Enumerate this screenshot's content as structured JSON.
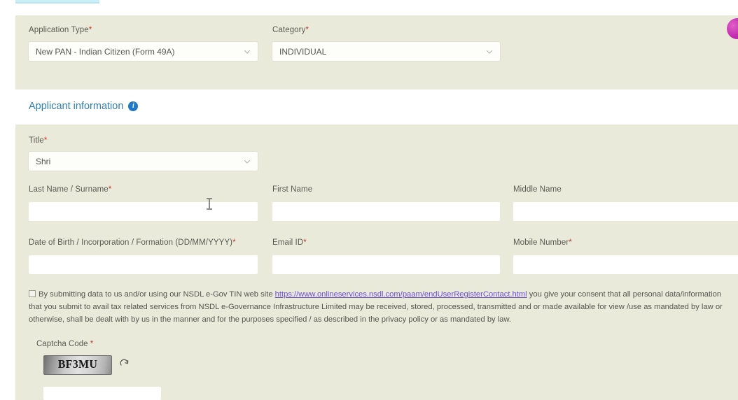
{
  "top_tab": {
    "present": true
  },
  "application_panel": {
    "application_type": {
      "label": "Application Type",
      "required": "*",
      "value": "New PAN - Indian Citizen (Form 49A)"
    },
    "category": {
      "label": "Category",
      "required": "*",
      "value": "INDIVIDUAL"
    }
  },
  "section": {
    "heading": "Applicant information",
    "info_icon": "info-icon",
    "info_glyph": "i"
  },
  "applicant_panel": {
    "title_field": {
      "label": "Title",
      "required": "*",
      "value": "Shri"
    },
    "last_name": {
      "label": "Last Name / Surname",
      "required": "*",
      "value": ""
    },
    "first_name": {
      "label": "First Name",
      "required": "",
      "value": ""
    },
    "middle_name": {
      "label": "Middle Name",
      "required": "",
      "value": ""
    },
    "dob": {
      "label": "Date of Birth / Incorporation / Formation (DD/MM/YYYY)",
      "required": "*",
      "value": ""
    },
    "email": {
      "label": "Email ID",
      "required": "*",
      "value": ""
    },
    "mobile": {
      "label": "Mobile Number",
      "required": "*",
      "value": ""
    }
  },
  "consent": {
    "checked": false,
    "text_before_link": "By submitting data to us and/or using our NSDL e-Gov TIN web site ",
    "link_text": "https://www.onlineservices.nsdl.com/paam/endUserRegisterContact.html",
    "text_after_link": " you give your consent that all personal data/information that you submit to avail tax related services from NSDL e-Governance Infrastructure Limited may be received, stored, processed, transmitted and or made available for view /use as mandated by law or otherwise, shall be dealt with by us in the manner and for the purposes specified / as described in the privacy policy or as mandated by law."
  },
  "captcha": {
    "label": "Captcha Code ",
    "required": "*",
    "code_text": "BF3MU",
    "refresh_icon": "refresh-icon",
    "input_value": ""
  },
  "floating_widget": {
    "icon": "chat-bubble-icon"
  },
  "colors": {
    "panel_background": "#eaeadb",
    "page_background": "#ffffff",
    "heading_blue": "#2f7fb5",
    "required_red": "#c0392b",
    "link_purple": "#6b4fd8",
    "info_icon_blue": "#1f78c8",
    "tab_cyan": "#cceef7",
    "widget_magenta": "#c32bb0",
    "label_text": "#5a5a52"
  }
}
